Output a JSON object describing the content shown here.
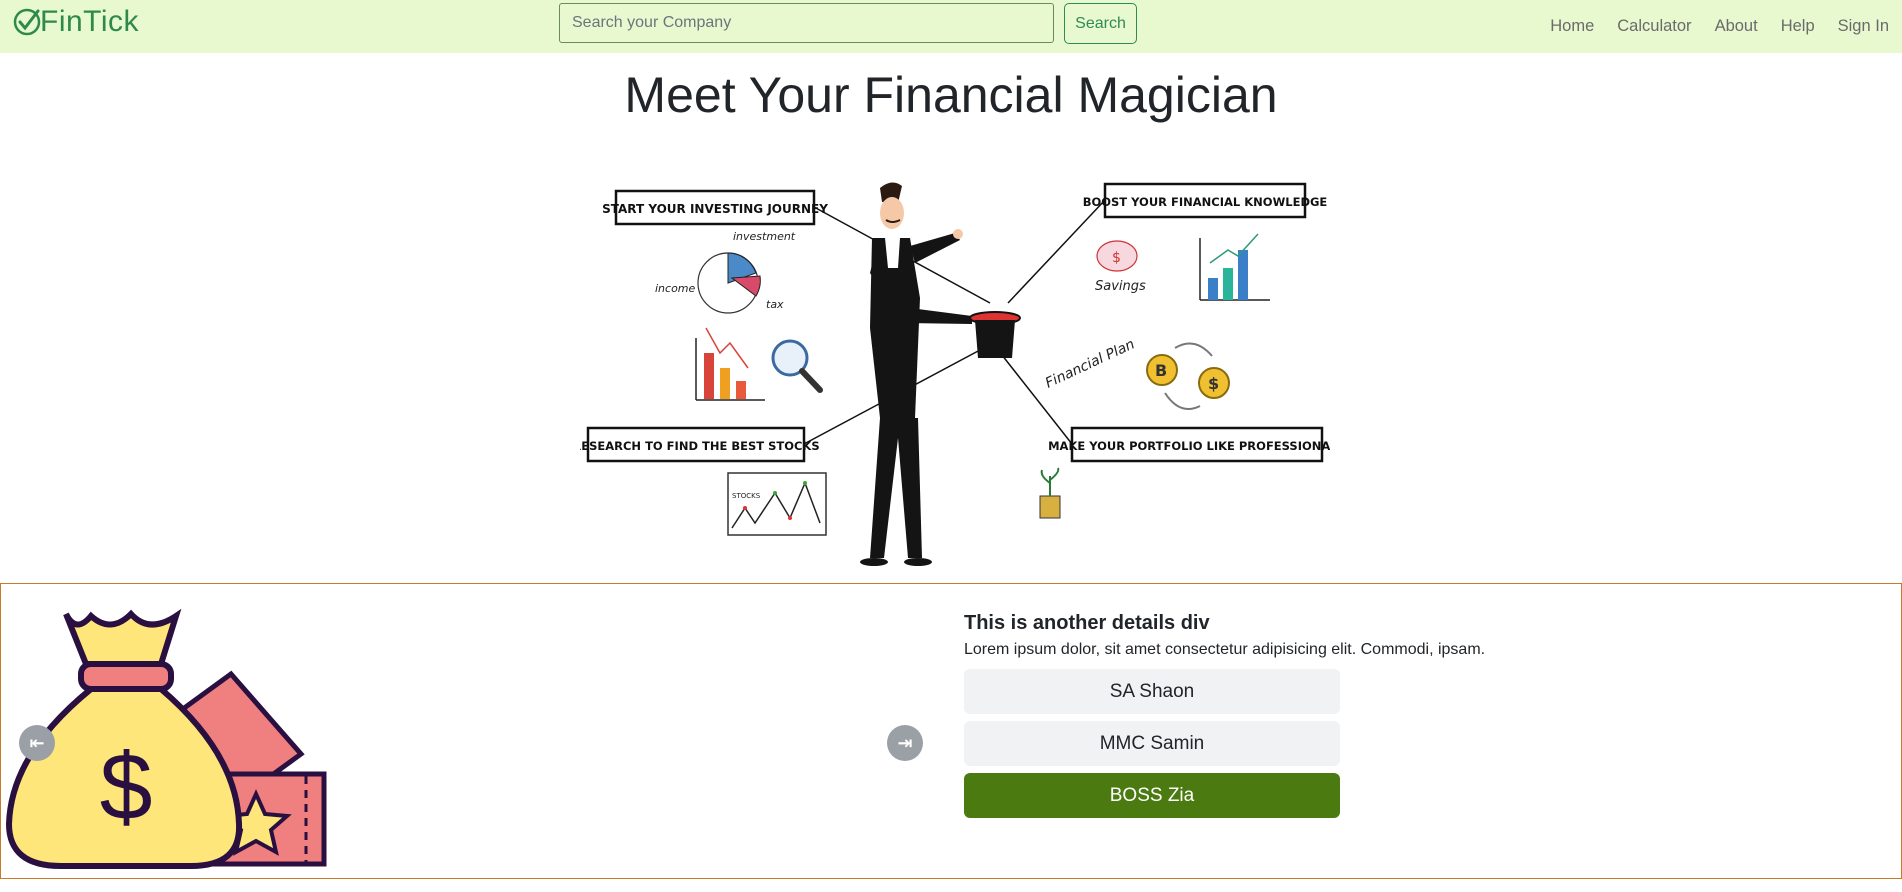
{
  "navbar": {
    "brand": "FinTick",
    "search_placeholder": "Search your Company",
    "search_label": "Search",
    "links": [
      "Home",
      "Calculator",
      "About",
      "Help",
      "Sign In"
    ]
  },
  "hero": {
    "title": "Meet Your Financial Magician",
    "labels": {
      "start": "START YOUR INVESTING JOURNEY",
      "boost": "BOOST YOUR FINANCIAL KNOWLEDGE",
      "research": "RESEARCH TO FIND THE BEST STOCKS",
      "portfolio": "MAKE YOUR PORTFOLIO LIKE PROFESSIONALS",
      "investment": "investment",
      "income": "income",
      "tax": "tax",
      "savings": "Savings",
      "plan": "Financial Plan",
      "stocks": "STOCKS"
    }
  },
  "details": {
    "heading": "This is another details div",
    "text": "Lorem ipsum dolor, sit amet consectetur adipisicing elit. Commodi, ipsam.",
    "people": [
      {
        "name": "SA Shaon",
        "active": false
      },
      {
        "name": "MMC Samin",
        "active": false
      },
      {
        "name": "BOSS Zia",
        "active": true
      }
    ],
    "carousel": {
      "prev_icon": "⇤",
      "next_icon": "⇥"
    }
  },
  "colors": {
    "navbar_bg": "#e8f8cf",
    "brand": "#2d8a4a",
    "active_button": "#4a7a10",
    "section_border": "#c77a29"
  }
}
